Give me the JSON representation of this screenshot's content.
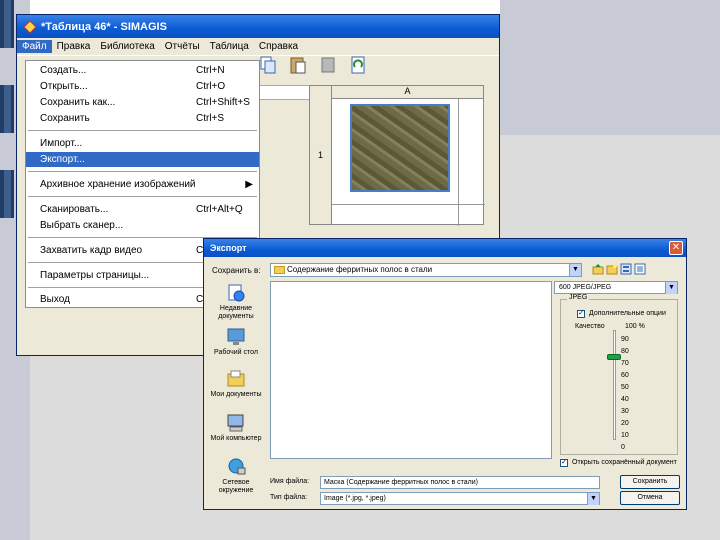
{
  "window": {
    "title": "*Таблица 46* - SIMAGIS"
  },
  "menubar": {
    "items": [
      "Файл",
      "Правка",
      "Библиотека",
      "Отчёты",
      "Таблица",
      "Справка"
    ]
  },
  "file_menu": {
    "items": [
      {
        "label": "Создать...",
        "shortcut": "Ctrl+N"
      },
      {
        "label": "Открыть...",
        "shortcut": "Ctrl+O"
      },
      {
        "label": "Сохранить как...",
        "shortcut": "Ctrl+Shift+S"
      },
      {
        "label": "Сохранить",
        "shortcut": "Ctrl+S"
      },
      {
        "label": "Импорт...",
        "shortcut": ""
      },
      {
        "label": "Экспорт...",
        "shortcut": ""
      },
      {
        "label": "Архивное хранение изображений",
        "shortcut": ""
      },
      {
        "label": "Сканировать...",
        "shortcut": "Ctrl+Alt+Q"
      },
      {
        "label": "Выбрать сканер...",
        "shortcut": ""
      },
      {
        "label": "Захватить кадр видео",
        "shortcut": "C"
      },
      {
        "label": "Параметры страницы...",
        "shortcut": ""
      },
      {
        "label": "Выход",
        "shortcut": "C"
      }
    ]
  },
  "grid": {
    "column_header": "A",
    "row_header": "1"
  },
  "dialog": {
    "title": "Экспорт",
    "save_in_label": "Сохранить в:",
    "save_in_value": "Содержание ферритных полос в стали",
    "places": [
      {
        "label": "Недавние документы"
      },
      {
        "label": "Рабочий стол"
      },
      {
        "label": "Мои документы"
      },
      {
        "label": "Мой компьютер"
      },
      {
        "label": "Сетевое окружение"
      }
    ],
    "format_value": "600 JPEG/JPEG",
    "group_label": "JPEG",
    "advanced_label": "Дополнительные опции",
    "quality_label": "Качество",
    "quality_value": "100 %",
    "ticks": [
      "100",
      "90",
      "80",
      "70",
      "60",
      "50",
      "40",
      "30",
      "20",
      "10",
      "0"
    ],
    "keep_label": "Открыть сохранённый документ",
    "filename_label": "Имя файла:",
    "filename_value": "Маска (Содержание ферритных полос в стали)",
    "filetype_label": "Тип файла:",
    "filetype_value": "Image (*.jpg, *.jpeg)",
    "save_button": "Сохранить",
    "cancel_button": "Отмена"
  }
}
